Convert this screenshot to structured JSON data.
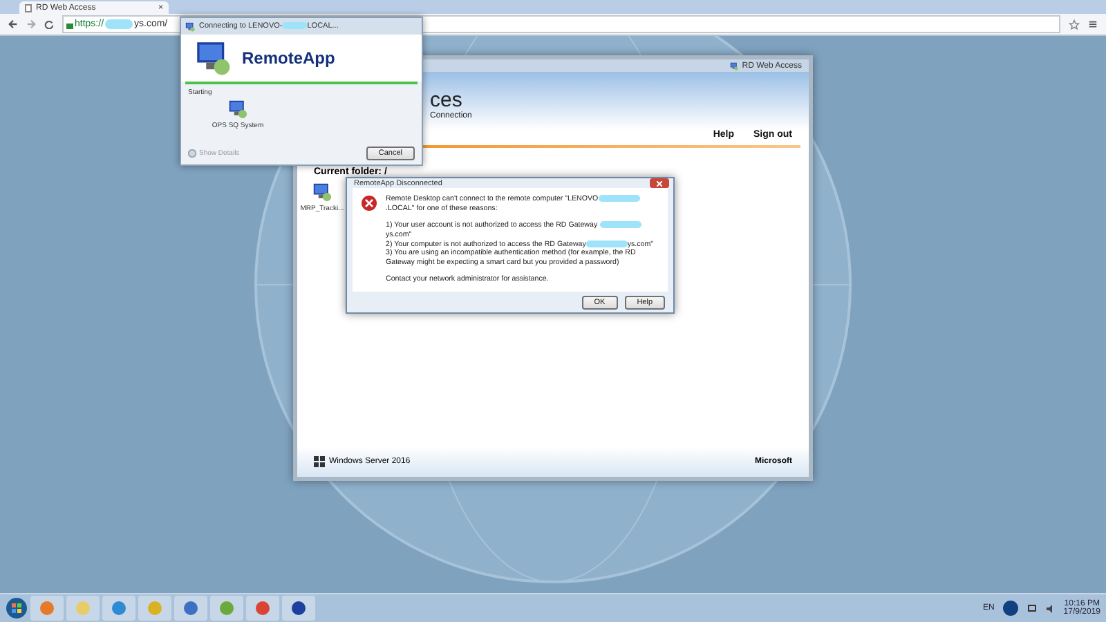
{
  "browser": {
    "tab_title": "RD Web Access",
    "tab_close": "×",
    "url_start": "https://",
    "url_end": "ys.com/"
  },
  "web_window": {
    "title": "RD Web Access",
    "heading_fragment": "ces",
    "subheading_fragment": "Connection",
    "nav": [
      "Help",
      "Sign out"
    ],
    "current_folder": "Current folder: /",
    "apps": [
      {
        "label": "MRP_Tracki..."
      }
    ],
    "footer_brand": "Windows Server 2016",
    "footer_vendor": "Microsoft"
  },
  "connecting_dialog": {
    "title_start": "Connecting to LENOVO-",
    "title_end": "LOCAL...",
    "heading": "RemoteApp",
    "status": "Starting",
    "app": "OPS SQ System",
    "details": "Show Details",
    "button": "Cancel"
  },
  "error_dialog": {
    "title": "RemoteApp Disconnected",
    "paragraphs": [
      [
        {
          "parts": [
            "Remote Desktop can't connect to the remote computer \"LENOVO",
            ".LOCAL\" for one of these reasons:"
          ]
        }
      ],
      [
        {
          "parts": [
            "1) Your user account is not authorized to access the RD Gateway ",
            "ys.com\""
          ]
        },
        {
          "parts": [
            "2) Your computer is not authorized to access the RD Gateway",
            "ys.com\""
          ]
        },
        {
          "parts": [
            "3) You are using an incompatible authentication method (for example, the RD Gateway might be expecting a smart card but you provided a password)"
          ]
        }
      ],
      [
        {
          "parts": [
            "Contact your network administrator for assistance."
          ]
        }
      ]
    ],
    "buttons": [
      "OK",
      "Help"
    ]
  },
  "taskbar": {
    "language": "EN",
    "time": "10:16 PM",
    "date": "17/9/2019"
  }
}
